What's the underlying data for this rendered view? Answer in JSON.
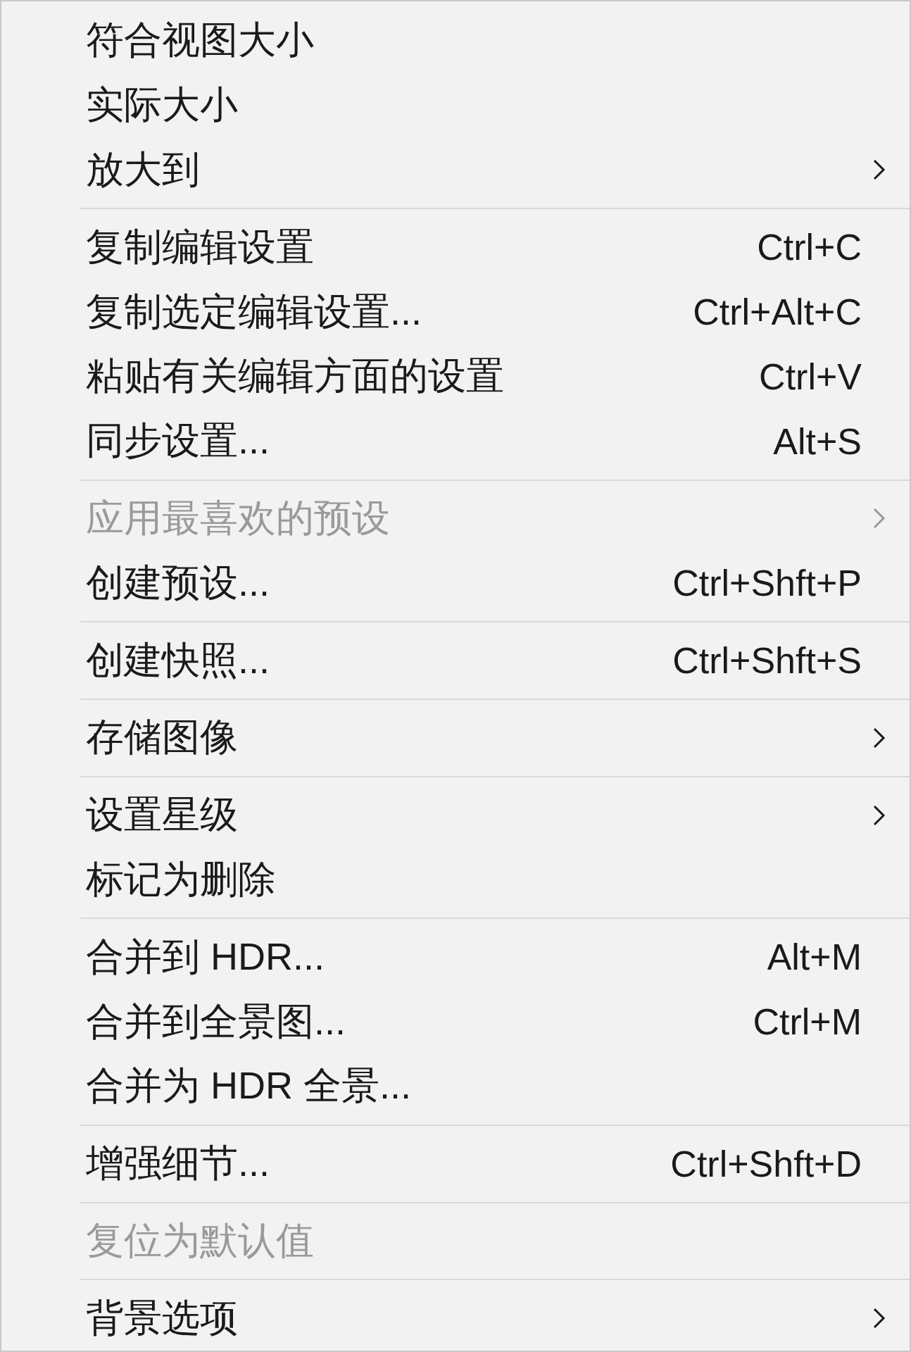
{
  "menu": {
    "groups": [
      {
        "items": [
          {
            "label": "符合视图大小",
            "disabled": false,
            "submenu": false
          },
          {
            "label": "实际大小",
            "disabled": false,
            "submenu": false
          },
          {
            "label": "放大到",
            "disabled": false,
            "submenu": true
          }
        ]
      },
      {
        "items": [
          {
            "label": "复制编辑设置",
            "shortcut": "Ctrl+C",
            "disabled": false,
            "submenu": false
          },
          {
            "label": "复制选定编辑设置...",
            "shortcut": "Ctrl+Alt+C",
            "disabled": false,
            "submenu": false
          },
          {
            "label": "粘贴有关编辑方面的设置",
            "shortcut": "Ctrl+V",
            "disabled": false,
            "submenu": false
          },
          {
            "label": "同步设置...",
            "shortcut": "Alt+S",
            "disabled": false,
            "submenu": false
          }
        ]
      },
      {
        "items": [
          {
            "label": "应用最喜欢的预设",
            "disabled": true,
            "submenu": true
          },
          {
            "label": "创建预设...",
            "shortcut": "Ctrl+Shft+P",
            "disabled": false,
            "submenu": false
          }
        ]
      },
      {
        "items": [
          {
            "label": "创建快照...",
            "shortcut": "Ctrl+Shft+S",
            "disabled": false,
            "submenu": false
          }
        ]
      },
      {
        "items": [
          {
            "label": "存储图像",
            "disabled": false,
            "submenu": true
          }
        ]
      },
      {
        "items": [
          {
            "label": "设置星级",
            "disabled": false,
            "submenu": true
          },
          {
            "label": "标记为删除",
            "disabled": false,
            "submenu": false
          }
        ]
      },
      {
        "items": [
          {
            "label": "合并到 HDR...",
            "shortcut": "Alt+M",
            "disabled": false,
            "submenu": false
          },
          {
            "label": "合并到全景图...",
            "shortcut": "Ctrl+M",
            "disabled": false,
            "submenu": false
          },
          {
            "label": "合并为 HDR 全景...",
            "disabled": false,
            "submenu": false
          }
        ]
      },
      {
        "items": [
          {
            "label": "增强细节...",
            "shortcut": "Ctrl+Shft+D",
            "disabled": false,
            "submenu": false
          }
        ]
      },
      {
        "items": [
          {
            "label": "复位为默认值",
            "disabled": true,
            "submenu": false
          }
        ]
      },
      {
        "items": [
          {
            "label": "背景选项",
            "disabled": false,
            "submenu": true
          }
        ]
      }
    ]
  }
}
